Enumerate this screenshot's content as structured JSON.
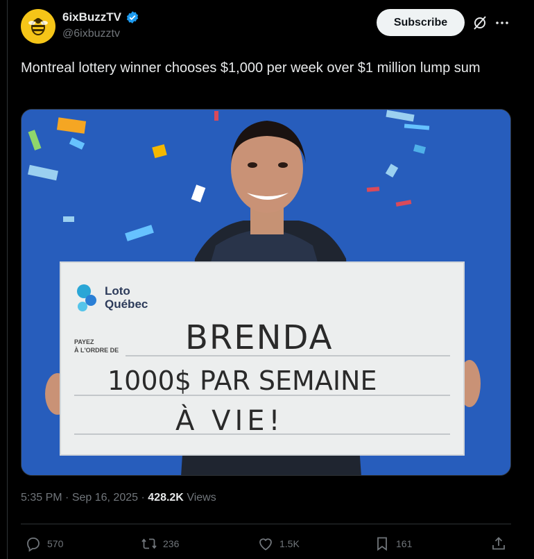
{
  "post": {
    "display_name": "6ixBuzzTV",
    "handle": "@6ixbuzztv",
    "subscribe_label": "Subscribe",
    "text": "Montreal lottery winner chooses $1,000 per week over $1 million lump sum",
    "time": "5:35 PM",
    "separator": "·",
    "date": "Sep 16, 2025",
    "views_count": "428.2K",
    "views_label": "Views"
  },
  "media": {
    "cheque_brand_line1": "Loto",
    "cheque_brand_line2": "Québec",
    "cheque_payee_label_1": "PAYEZ",
    "cheque_payee_label_2": "À L'ORDRE DE",
    "cheque_line1": "BRENDA",
    "cheque_line2": "1000$ PAR SEMAINE",
    "cheque_line3": "À VIE!"
  },
  "actions": {
    "replies": "570",
    "reposts": "236",
    "likes": "1.5K",
    "bookmarks": "161"
  },
  "icons": [
    "verified-badge-icon",
    "grok-icon",
    "more-icon",
    "reply-icon",
    "repost-icon",
    "like-icon",
    "bookmark-icon",
    "share-icon"
  ],
  "colors": {
    "accent": "#1d9bf0",
    "background": "#000000",
    "text": "#e7e9ea",
    "muted": "#71767b"
  }
}
